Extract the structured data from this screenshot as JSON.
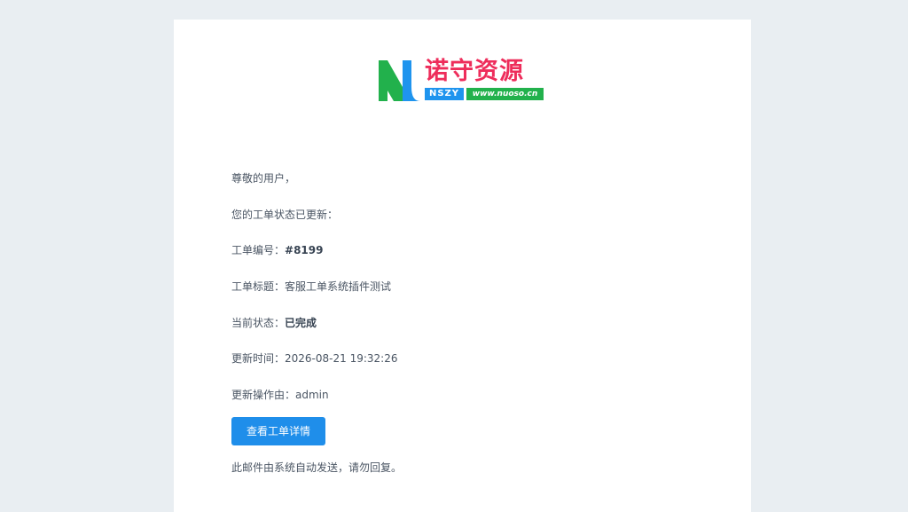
{
  "logo": {
    "brand": "诺守资源",
    "abbr": "NSZY",
    "site": "www.nuoso.cn",
    "colors": {
      "mark_green": "#22b14c",
      "mark_blue": "#1f94ee",
      "brand_red": "#ee2d5b"
    }
  },
  "email": {
    "greeting": "尊敬的用户，",
    "intro": "您的工单状态已更新：",
    "ticket_no_label": "工单编号：",
    "ticket_no_value": "#8199",
    "ticket_title_label": "工单标题：",
    "ticket_title_value": "客服工单系统插件测试",
    "status_label": "当前状态：",
    "status_value": "已完成",
    "updated_time_label": "更新时间：",
    "updated_time_value": "2026-08-21 19:32:26",
    "operator_label": "更新操作由：",
    "operator_value": "admin",
    "button_label": "查看工单详情",
    "footer_note": "此邮件由系统自动发送，请勿回复。"
  },
  "colors": {
    "background": "#e9eef2",
    "card": "#ffffff",
    "text": "#4a5563",
    "button": "#1f8eea"
  }
}
